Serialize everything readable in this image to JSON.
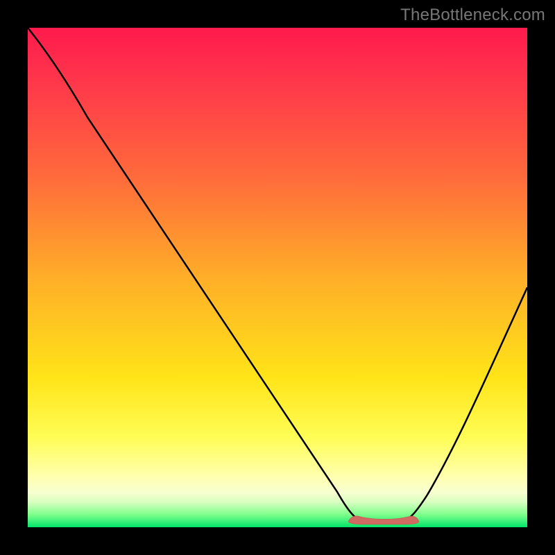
{
  "watermark": "TheBottleneck.com",
  "chart_data": {
    "type": "line",
    "title": "",
    "xlabel": "",
    "ylabel": "",
    "xlim": [
      0,
      100
    ],
    "ylim": [
      0,
      100
    ],
    "grid": false,
    "legend": false,
    "description": "Bottleneck-style V-curve over a vertical rainbow heatmap (red at top = high bottleneck, green at bottom = optimal). Curve minimum marks the balanced-configuration zone.",
    "series": [
      {
        "name": "bottleneck-curve",
        "color": "#000000",
        "x": [
          0,
          5,
          10,
          15,
          20,
          25,
          30,
          35,
          40,
          45,
          50,
          55,
          60,
          63,
          66,
          70,
          74,
          77,
          80,
          85,
          90,
          95,
          100
        ],
        "y": [
          100,
          94,
          88,
          81,
          74,
          67,
          59,
          51,
          43,
          35,
          27,
          19,
          11,
          4,
          1,
          0,
          0,
          1,
          4,
          12,
          22,
          33,
          45
        ]
      },
      {
        "name": "optimal-zone-marker",
        "color": "#d06a60",
        "shape": "blob",
        "x": [
          63,
          77
        ],
        "y": [
          0.8,
          0.8
        ]
      }
    ]
  }
}
